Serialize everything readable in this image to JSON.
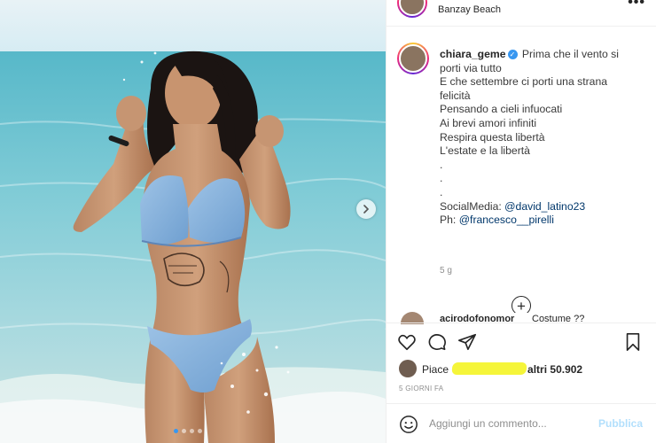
{
  "post": {
    "location": "Banzay Beach",
    "more_icon": "more-horizontal-icon",
    "caption": {
      "username": "chiara_geme",
      "lines": [
        "Prima che il vento si",
        "porti via tutto",
        "E che settembre ci porti una strana",
        "felicità",
        "Pensando a cieli infuocati",
        "Ai brevi amori infiniti",
        "Respira questa libertà",
        "L'estate e la libertà",
        ".",
        ".",
        "."
      ],
      "social_label": "SocialMedia: ",
      "social_mention": "@david_latino23",
      "ph_label": "Ph: ",
      "ph_mention": "@francesco__pirelli"
    },
    "time_ago": "5 g",
    "load_more_icon": "plus-circle-icon",
    "comment_peek": {
      "user": "acirodofonomor",
      "text": "Costume ??"
    }
  },
  "actions": {
    "like_icon": "heart-icon",
    "comment_icon": "comment-icon",
    "share_icon": "send-icon",
    "save_icon": "bookmark-icon"
  },
  "likes": {
    "prefix": "Piace",
    "suffix": "altri",
    "count": "50.902"
  },
  "date_label": "5 GIORNI FA",
  "comment_box": {
    "emoji_icon": "smiley-icon",
    "placeholder": "Aggiungi un commento...",
    "post_label": "Pubblica"
  },
  "carousel": {
    "slides": 4,
    "active_index": 0,
    "next_icon": "chevron-right-icon"
  },
  "colors": {
    "accent": "#3897f0",
    "post_button_disabled": "#b2dffc",
    "highlight": "#f5f53a"
  }
}
